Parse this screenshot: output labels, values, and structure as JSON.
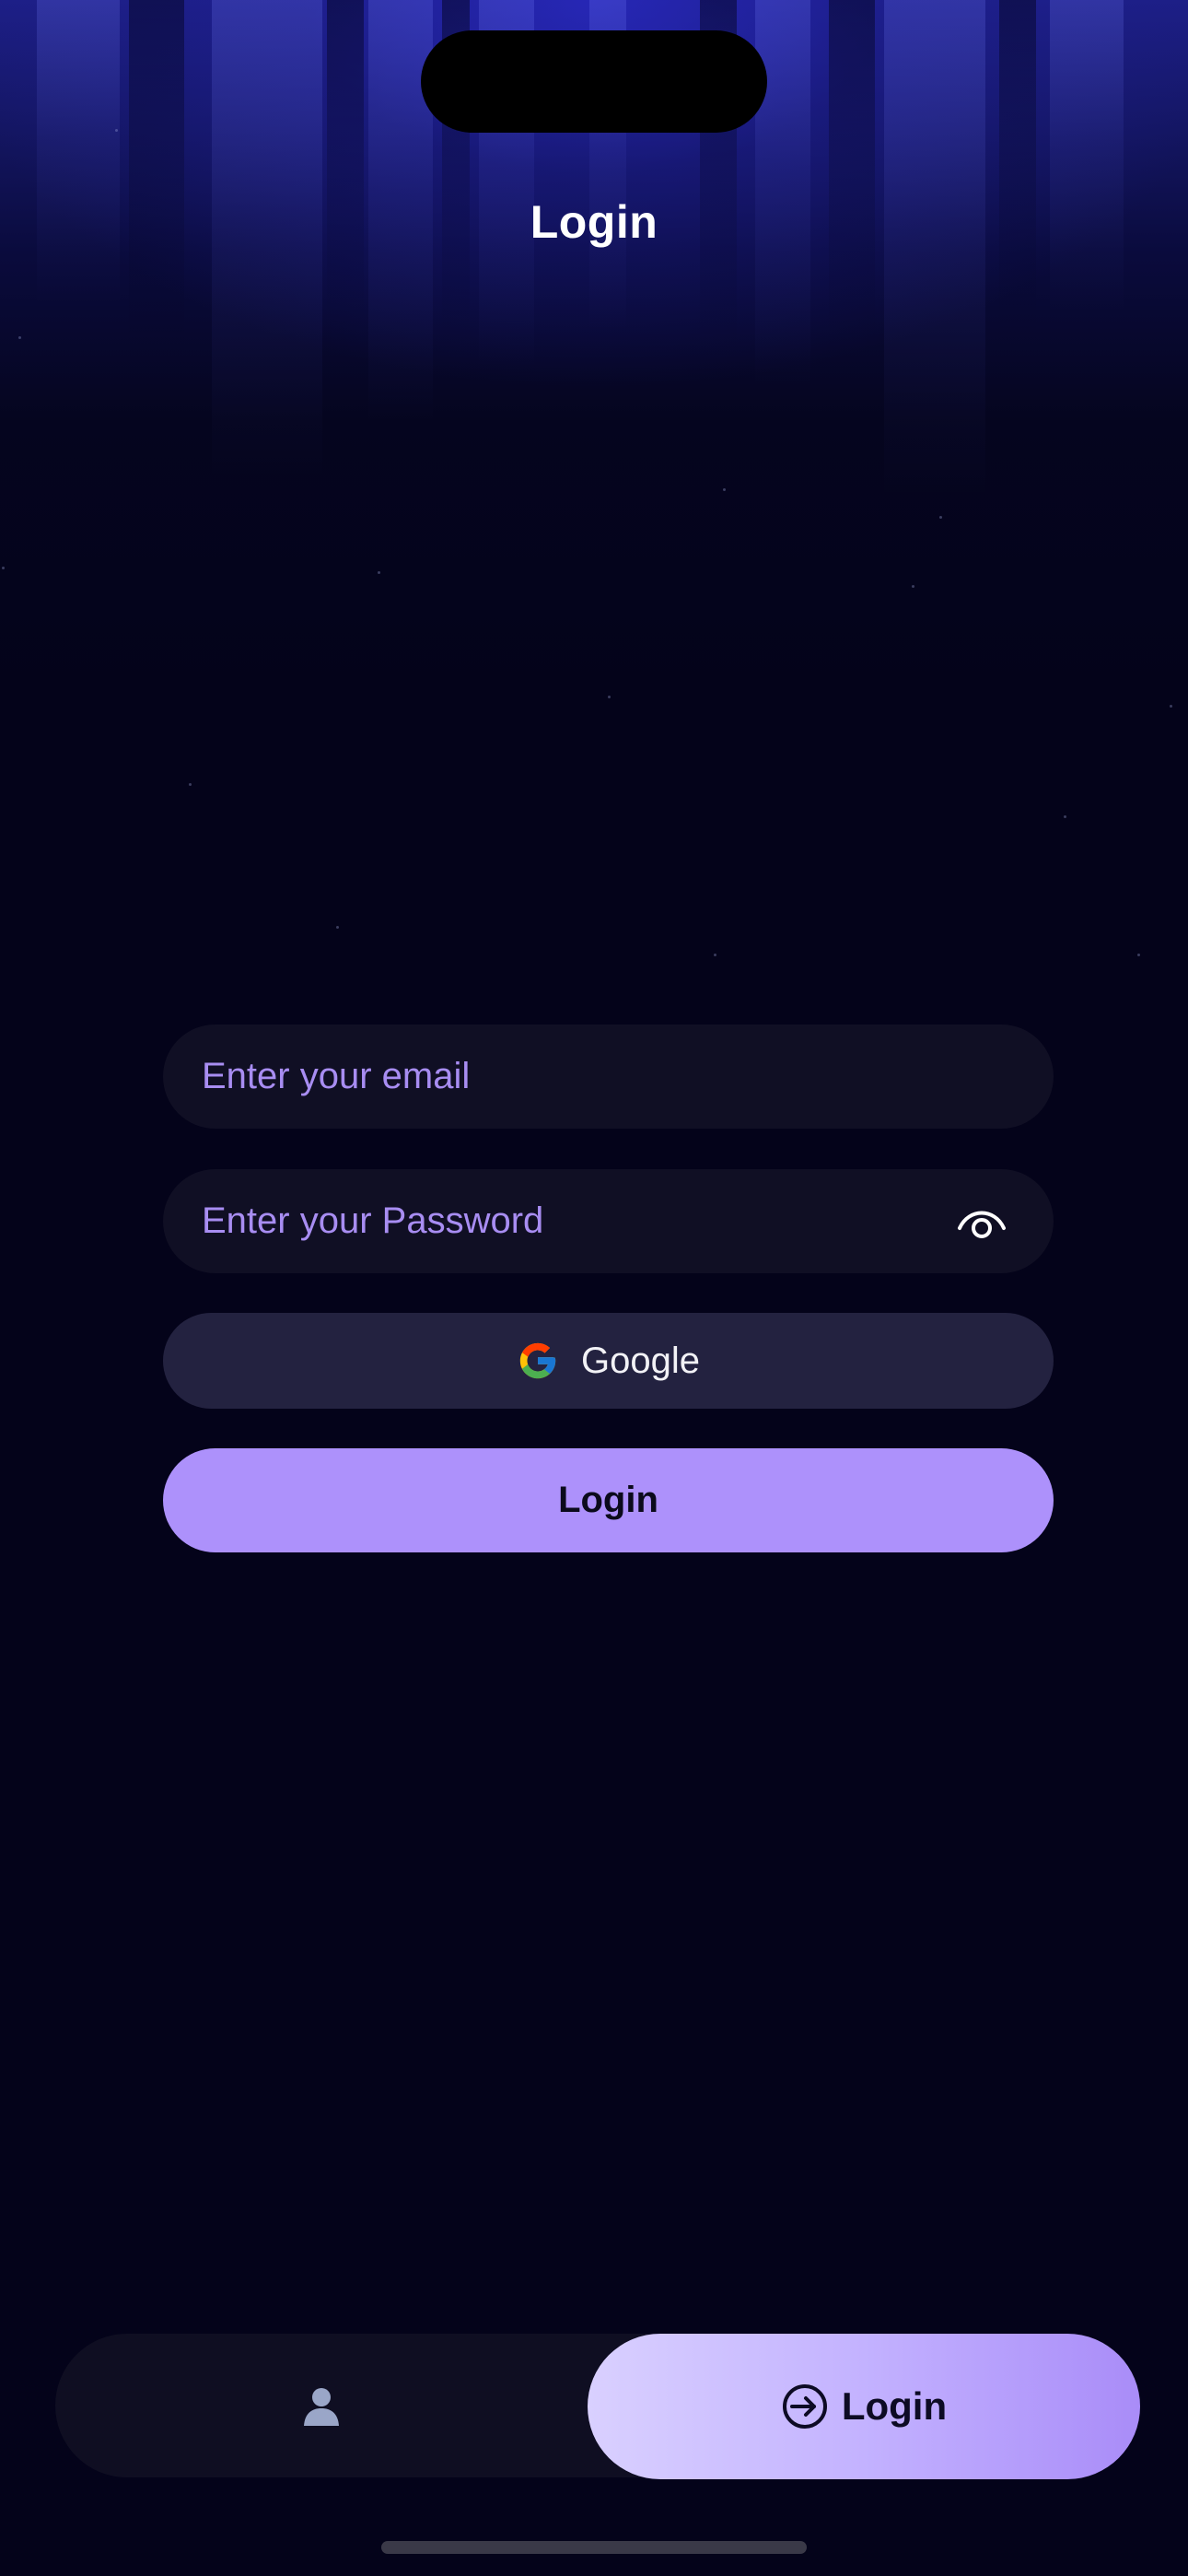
{
  "header": {
    "title": "Login"
  },
  "form": {
    "email_placeholder": "Enter your email",
    "password_placeholder": "Enter your Password",
    "password_toggle_icon": "eye-icon",
    "google_label": "Google",
    "google_icon": "google-logo-icon",
    "login_label": "Login"
  },
  "tabbar": {
    "items": [
      {
        "icon": "user-icon",
        "label": "",
        "active": false
      },
      {
        "icon": "login-arrow-icon",
        "label": "Login",
        "active": true
      }
    ]
  },
  "colors": {
    "background": "#04031a",
    "accent": "#ad91fb",
    "placeholder": "#a88df2",
    "field_background": "#100f24",
    "google_button_background": "#232240"
  }
}
